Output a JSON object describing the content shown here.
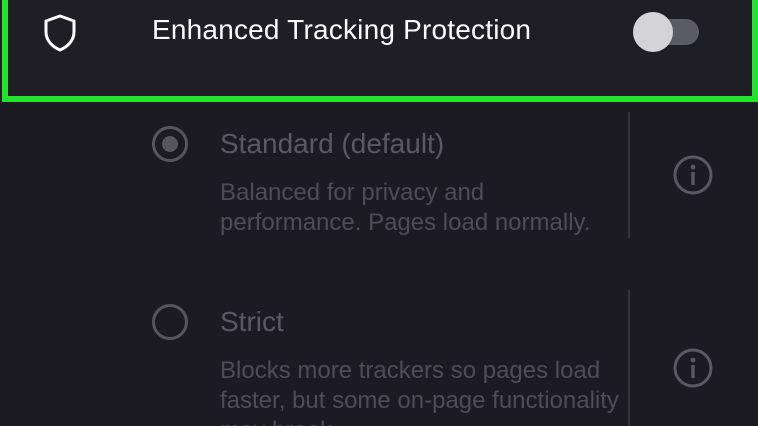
{
  "tracking_protection": {
    "label": "Enhanced Tracking Protection",
    "enabled": false,
    "icon": "shield-icon"
  },
  "options": [
    {
      "title": "Standard (default)",
      "description": "Balanced for privacy and performance. Pages load normally.",
      "selected": true,
      "icon": "info-icon"
    },
    {
      "title": "Strict",
      "description": "Blocks more trackers so pages load faster, but some on-page functionality may break.",
      "selected": false,
      "icon": "info-icon"
    }
  ],
  "colors": {
    "background": "#1c1b22",
    "highlight": "#21e32d",
    "text_primary": "#fbfbfe",
    "text_disabled": "#5a5961"
  }
}
